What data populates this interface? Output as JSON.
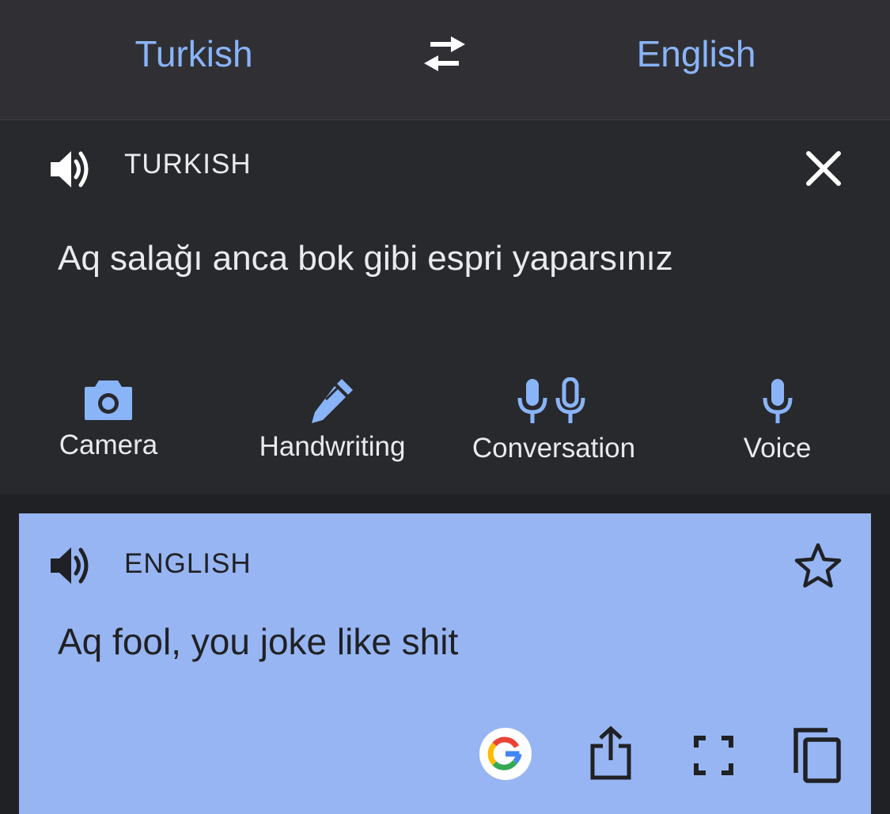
{
  "language_bar": {
    "source_language": "Turkish",
    "target_language": "English",
    "swap_icon": "swap-arrows-icon"
  },
  "source_panel": {
    "language_label": "TURKISH",
    "speaker_icon": "speaker-icon",
    "close_icon": "close-icon",
    "text": "Aq salağı anca bok gibi espri yaparsınız"
  },
  "input_tools": [
    {
      "label": "Camera",
      "icon": "camera-icon"
    },
    {
      "label": "Handwriting",
      "icon": "pen-icon"
    },
    {
      "label": "Conversation",
      "icon": "double-mic-icon"
    },
    {
      "label": "Voice",
      "icon": "mic-icon"
    }
  ],
  "result_card": {
    "language_label": "ENGLISH",
    "speaker_icon": "speaker-icon",
    "star_icon": "star-outline-icon",
    "text": "Aq fool, you joke like shit",
    "actions": [
      "google-logo-icon",
      "share-icon",
      "fullscreen-icon",
      "copy-icon"
    ]
  },
  "colors": {
    "accent": "#8ab4f8",
    "top_bar_bg": "#303034",
    "source_panel_bg": "#28292d",
    "result_card_bg": "#97b5f2",
    "text_light": "#e8eaed",
    "text_dark": "#202124"
  }
}
